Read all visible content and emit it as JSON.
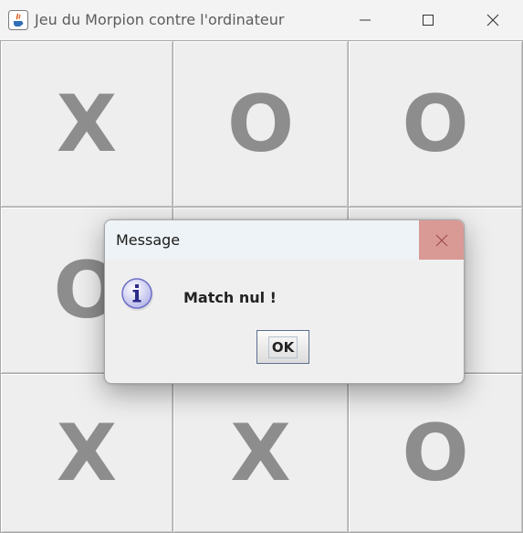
{
  "window": {
    "title": "Jeu du Morpion contre l'ordinateur",
    "icon": "java-cup-icon",
    "controls": [
      "minimize-icon",
      "maximize-icon",
      "close-icon"
    ]
  },
  "board": {
    "cells": [
      "X",
      "O",
      "O",
      "O",
      "",
      "",
      "X",
      "X",
      "O"
    ]
  },
  "dialog": {
    "title": "Message",
    "icon": "info-icon",
    "message": "Match nul !",
    "ok_label": "OK",
    "close_icon": "close-icon"
  },
  "colors": {
    "mark": "#8d8d8d",
    "cell_bg": "#eeeeee",
    "dialog_close_bg": "#d99a96",
    "dialog_titlebar_bg": "#eef3f7"
  }
}
